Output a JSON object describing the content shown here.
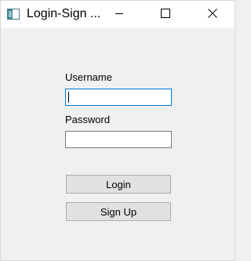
{
  "window": {
    "title": "Login-Sign ...",
    "icon": "app-window-icon",
    "controls": {
      "minimize_icon": "minimize-icon",
      "maximize_icon": "maximize-icon",
      "close_icon": "close-icon"
    }
  },
  "form": {
    "username_label": "Username",
    "username_value": "",
    "password_label": "Password",
    "password_value": "",
    "login_label": "Login",
    "signup_label": "Sign Up"
  },
  "colors": {
    "focus_border": "#0078d7",
    "button_bg": "#e1e1e1",
    "window_bg": "#f0f0f0"
  }
}
